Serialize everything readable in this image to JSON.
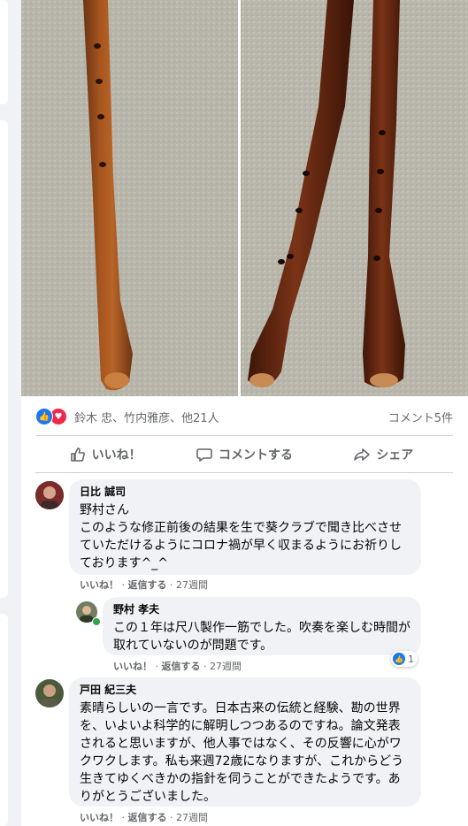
{
  "reactions": {
    "names": "鈴木 忠、竹内雅彦、他21人",
    "comments_count": "コメント5件"
  },
  "actions": {
    "like": "いいね！",
    "comment": "コメントする",
    "share": "シェア"
  },
  "comments": [
    {
      "author": "日比 誠司",
      "text": "野村さん\nこのような修正前後の結果を生で葵クラブで聞き比べさせていただけるようにコロナ禍が早く収まるようにお祈りしております^_^",
      "like": "いいね！",
      "reply": "返信する",
      "time": "27週間"
    },
    {
      "author": "野村 孝夫",
      "text": "この１年は尺八製作一筋でした。吹奏を楽しむ時間が取れていないのが問題です。",
      "like": "いいね！",
      "reply": "返信する",
      "time": "27週間",
      "reaction_count": "1"
    },
    {
      "author": "戸田 紀三夫",
      "text": "素晴らしいの一言です。日本古来の伝統と経験、勘の世界を、いよいよ科学的に解明しつつあるのですね。論文発表されると思いますが、他人事ではなく、その反響に心がワクワクします。私も来週72歳になりますが、これからどう生きてゆくべきかの指針を伺うことができたようです。ありがとうございました。",
      "like": "いいね！",
      "reply": "返信する",
      "time": "27週間"
    }
  ],
  "colors": {
    "accent": "#1877f2",
    "love": "#f0284a",
    "secondary_text": "#65676b",
    "bubble": "#f0f2f5"
  }
}
